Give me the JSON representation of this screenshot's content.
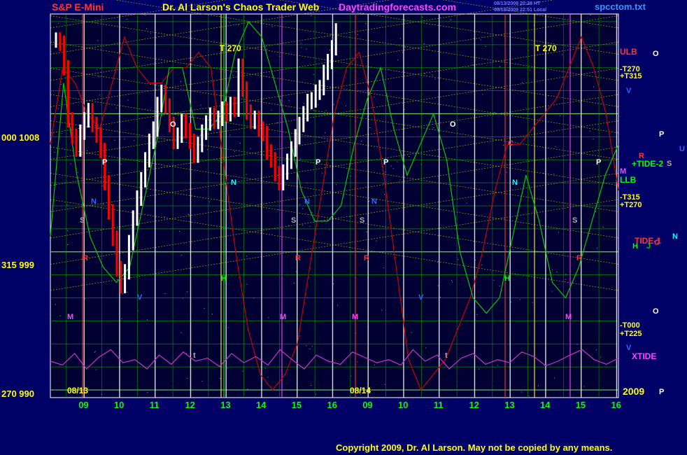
{
  "header": {
    "symbol": "S&P E-Mini",
    "title": "Dr. Al Larson's Chaos Trader Web",
    "site": "Daytradingforecasts.com",
    "file": "spcctom.txt",
    "stamp_1": "08/13/2009 20:28 HT",
    "stamp_2": "08/13/2009 22:51 Local"
  },
  "footer": {
    "copyright": "Copyright 2009, Dr. Al Larson. May not be copied by any means."
  },
  "colors": {
    "background": "#000066",
    "plot_bg": "#000033",
    "grid": "#00aa00",
    "lattice": "#cccc00",
    "price_up": "#ffffff",
    "price_down": "#ff0000",
    "red_line": "#cc0000",
    "green_line": "#00cc00",
    "xtide": "#cc33cc",
    "time_bar": "#ffffff",
    "date_label": "#ffff00",
    "hour_label": "#00ff00"
  },
  "chart_data": {
    "type": "line",
    "title": "S&P E-Mini",
    "x_hours": [
      "09",
      "10",
      "11",
      "12",
      "13",
      "14",
      "15",
      "16",
      "09",
      "10",
      "11",
      "12",
      "13",
      "14",
      "15",
      "16"
    ],
    "dates": [
      "08/13",
      "08/14"
    ],
    "year": "2009",
    "y_left_labels": [
      "000  1008",
      "315  999",
      "270  990"
    ],
    "y_ticks": [
      1008,
      999,
      990
    ],
    "ylim": [
      989.5,
      1014.5
    ],
    "right_labels": [
      "ULB",
      "-T270",
      "+T315",
      "+TIDE-2",
      "LLB",
      "-T315",
      "+T270",
      "TIDE-1",
      "-T000",
      "+T225",
      "XTIDE"
    ],
    "right_markers": [
      "O",
      "V",
      "P",
      "R",
      "M",
      "U",
      "S",
      "C",
      "H",
      "J",
      "N",
      "O",
      "V",
      "P"
    ],
    "t270_label": "T  270",
    "markers": {
      "P": "P",
      "S": "S",
      "R": "R",
      "M": "M",
      "V": "V",
      "O": "O",
      "N": "N",
      "C": "C",
      "H": "H",
      "t": "t"
    },
    "price_close": [
      1012.8,
      1012.6,
      1011.0,
      1007.6,
      1006.5,
      1005.7,
      1006.8,
      1007.6,
      1008.2,
      1007.3,
      1006.6,
      1005.6,
      1003.5,
      1001.6,
      999.9,
      997.9,
      996.8,
      997.7,
      999.6,
      1001.2,
      1002.5,
      1003.7,
      1005.0,
      1006.2,
      1007.0,
      1008.6,
      1009.4,
      1008.5,
      1007.3,
      1006.2,
      1006.6,
      1007.5,
      1006.9,
      1006.2,
      1005.3,
      1006.0,
      1006.8,
      1007.4,
      1007.9,
      1007.5,
      1007.7,
      1008.3,
      1008.0,
      1008.6,
      1008.3,
      1011.1,
      1009.6,
      1008.1,
      1007.5,
      1007.7,
      1007.0,
      1006.7,
      1005.5,
      1005.0,
      1004.1,
      1003.5,
      1004.2,
      1004.9,
      1005.7,
      1006.5,
      1007.3,
      1008.0,
      1008.8,
      1008.9,
      1009.4,
      1009.7,
      1010.7,
      1011.4,
      1012.3,
      1013.4
    ],
    "red_line": [
      1006,
      1011,
      1010,
      1008,
      1007,
      1010,
      1013,
      1011,
      1010,
      1010,
      1011,
      1011,
      1012,
      1011,
      1005,
      999,
      994,
      991,
      990,
      991,
      993,
      998,
      1003,
      1008,
      1011,
      1012,
      1009,
      1004,
      998,
      992,
      990,
      991,
      992,
      994,
      996,
      999,
      1003,
      1006,
      1006,
      1007,
      1008,
      1009,
      1011,
      1013,
      1011,
      1008,
      1003
    ],
    "green_line": [
      1000,
      1010,
      1004,
      1000,
      998,
      997,
      998,
      1002,
      1006,
      1011,
      1011,
      1007,
      1007,
      1008,
      1012,
      1014,
      1013,
      1010,
      1007,
      1003,
      1001,
      1001,
      1002,
      1006,
      1009,
      1011,
      1007,
      1004,
      1006,
      1008,
      1005,
      999,
      996,
      995,
      996,
      1000,
      1004,
      1001,
      997,
      996,
      998,
      1001,
      1004,
      1006
    ],
    "xtide": [
      40,
      35,
      50,
      30,
      45,
      55,
      38,
      42,
      30,
      48,
      36,
      52,
      40,
      44,
      33,
      50,
      38,
      46,
      35,
      55,
      42,
      30,
      48,
      40,
      36,
      52,
      45,
      38,
      42,
      35,
      55,
      40,
      48,
      30,
      44,
      50,
      36,
      42,
      38,
      52,
      46,
      34,
      40,
      48,
      55,
      42,
      36,
      44
    ]
  }
}
